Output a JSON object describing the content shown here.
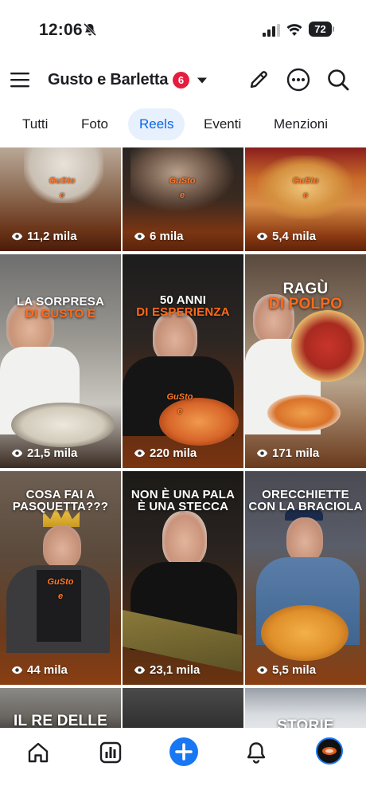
{
  "status_bar": {
    "time": "12:06",
    "battery": "72"
  },
  "header": {
    "title": "Gusto e Barletta",
    "badge_count": "6"
  },
  "tabs": [
    {
      "label": "Tutti",
      "active": false
    },
    {
      "label": "Foto",
      "active": false
    },
    {
      "label": "Reels",
      "active": true
    },
    {
      "label": "Eventi",
      "active": false
    },
    {
      "label": "Menzioni",
      "active": false
    }
  ],
  "reels": [
    {
      "views": "11,2 mila"
    },
    {
      "views": "6 mila"
    },
    {
      "views": "5,4 mila"
    },
    {
      "views": "21,5 mila",
      "caption_a": "LA SORPRESA",
      "caption_b": "DI GUSTO È"
    },
    {
      "views": "220 mila",
      "caption_a": "50 ANNI",
      "caption_b": "DI ESPERIENZA"
    },
    {
      "views": "171 mila",
      "caption_a": "RAGÙ",
      "caption_b": "DI POLPO"
    },
    {
      "views": "44 mila",
      "caption_a": "COSA FAI A",
      "caption_b": "PASQUETTA???"
    },
    {
      "views": "23,1 mila",
      "caption_a": "NON È UNA PALA",
      "caption_b": "È UNA STECCA"
    },
    {
      "views": "5,5 mila",
      "caption_a": "ORECCHIETTE",
      "caption_b": "CON LA BRACIOLA"
    },
    {
      "caption_a": "IL RE DELLE"
    },
    {},
    {
      "caption_a": "STORIE"
    }
  ],
  "logo_text": "GuSto e",
  "colors": {
    "accent": "#1877f2",
    "badge": "#e41e3f",
    "brand_orange": "#ff6a1a",
    "active_tab_bg": "#e7f0fd"
  },
  "icons": {
    "header": [
      "menu-icon",
      "edit-icon",
      "more-icon",
      "search-icon"
    ],
    "bottom_nav": [
      "home-icon",
      "stats-icon",
      "create-icon",
      "notifications-icon",
      "profile-avatar"
    ]
  }
}
